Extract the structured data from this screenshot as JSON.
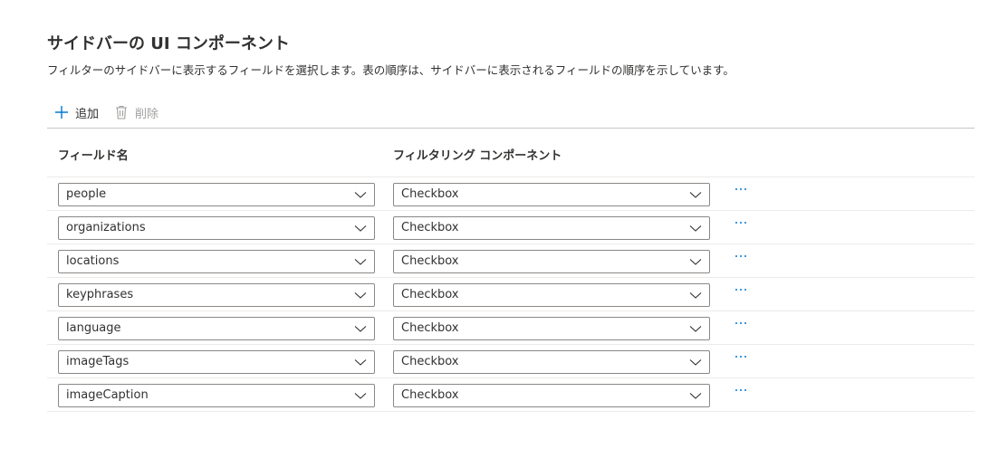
{
  "section": {
    "title": "サイドバーの UI コンポーネント",
    "description": "フィルターのサイドバーに表示するフィールドを選択します。表の順序は、サイドバーに表示されるフィールドの順序を示しています。"
  },
  "toolbar": {
    "add_label": "追加",
    "delete_label": "削除",
    "add_icon": "plus-icon",
    "delete_icon": "trash-icon",
    "accent_color": "#0078d4",
    "disabled_color": "#a19f9d"
  },
  "table": {
    "columns": [
      "フィールド名",
      "フィルタリング コンポーネント"
    ],
    "rows": [
      {
        "field": "people",
        "component": "Checkbox"
      },
      {
        "field": "organizations",
        "component": "Checkbox"
      },
      {
        "field": "locations",
        "component": "Checkbox"
      },
      {
        "field": "keyphrases",
        "component": "Checkbox"
      },
      {
        "field": "language",
        "component": "Checkbox"
      },
      {
        "field": "imageTags",
        "component": "Checkbox"
      },
      {
        "field": "imageCaption",
        "component": "Checkbox"
      }
    ],
    "row_action_icon": "more-horizontal-icon",
    "dropdown_icon": "chevron-down-icon"
  }
}
